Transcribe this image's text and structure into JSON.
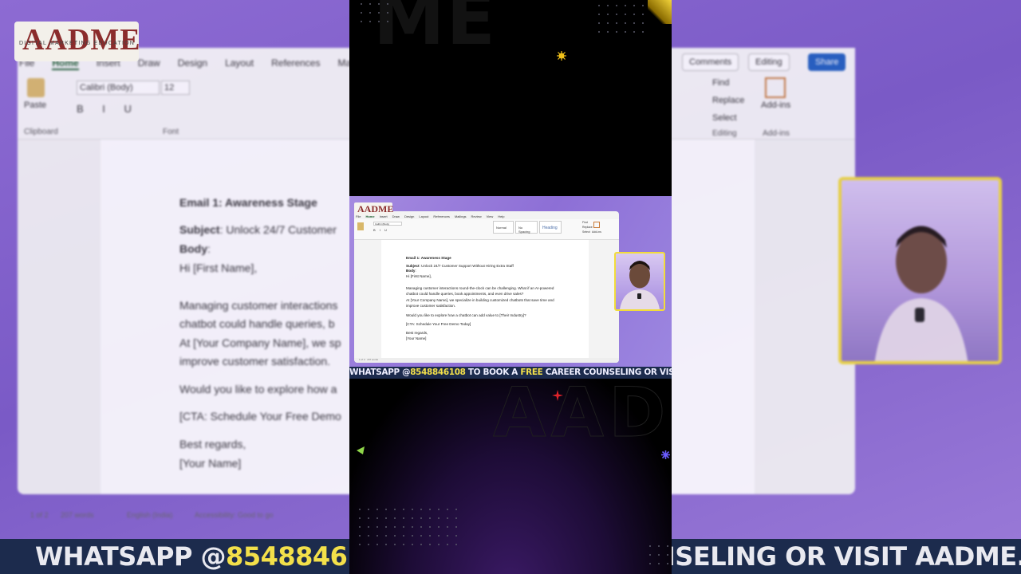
{
  "brand": {
    "logo_text": "AADME",
    "logo_tagline": "DIGITAL MARKETING EDUCATION"
  },
  "ribbon": {
    "tabs": [
      "File",
      "Home",
      "Insert",
      "Draw",
      "Design",
      "Layout",
      "References",
      "Mailings",
      "Re"
    ],
    "mini_tabs": [
      "File",
      "Home",
      "Insert",
      "Draw",
      "Design",
      "Layout",
      "References",
      "Mailings",
      "Review",
      "View",
      "Help"
    ],
    "active_tab": "Home",
    "font_name": "Calibri (Body)",
    "font_size": "12",
    "paste_label": "Paste",
    "clipboard_label": "Clipboard",
    "font_group_label": "Font",
    "comments_label": "Comments",
    "editing_label": "Editing",
    "share_label": "Share",
    "find_label": "Find",
    "replace_label": "Replace",
    "select_label": "Select",
    "editing_group_label": "Editing",
    "addins_label": "Add-ins",
    "addins_group_label": "Add-ins",
    "styles": [
      "Normal",
      "No Spacing",
      "Heading"
    ]
  },
  "document": {
    "heading": "Email 1: Awareness Stage",
    "subject_label": "Subject",
    "subject_text": ": Unlock 24/7 Customer Support Without Hiring Extra Staff",
    "bg_subject_text": ": Unlock 24/7 Customer",
    "body_label": "Body",
    "greeting": "Hi [First Name],",
    "para1_line1": "Managing customer interactions round-the-clock can be challenging. What if an AI-powered",
    "para1_line2": "chatbot could handle queries, book appointments, and even drive sales?",
    "para1_line3": "At [Your Company Name], we specialize in building customized chatbots that save time and",
    "para1_line4": "improve customer satisfaction.",
    "bg_para1_line1": "Managing customer interactions",
    "bg_para1_line2": "chatbot could handle queries, b",
    "bg_para1_line3": "At [Your Company Name], we sp",
    "question": "Would you like to explore how a chatbot can add value to [Their Industry]?",
    "bg_question": "Would you like to explore how a",
    "cta": "[CTA: Schedule Your Free Demo Today]",
    "bg_cta": "[CTA: Schedule Your Free Demo",
    "closing": "Best regards,",
    "signature": "[Your Name]"
  },
  "status_bar": {
    "page": "1 of 2",
    "words": "207 words",
    "language": "English (India)",
    "accessibility": "Accessibility: Good to go"
  },
  "banner": {
    "part1": "WHATSAPP @",
    "phone": "8548846108",
    "part2": " TO BOOK A ",
    "free": "FREE",
    "part3": " CAREER COUNSELING OR VISIT AADME.CO",
    "bg_part1": "WHATSAPP @",
    "bg_phone": "8548846108",
    "bg_part2": " TO",
    "bg_part3": "NSELING OR VISIT AADME.CO"
  },
  "colors": {
    "accent_yellow": "#f3e04a",
    "banner_bg": "#1c2b4d",
    "purple_bg": "#8d6fd6",
    "word_green": "#1a5c2b",
    "share_blue": "#1f5fbf"
  }
}
